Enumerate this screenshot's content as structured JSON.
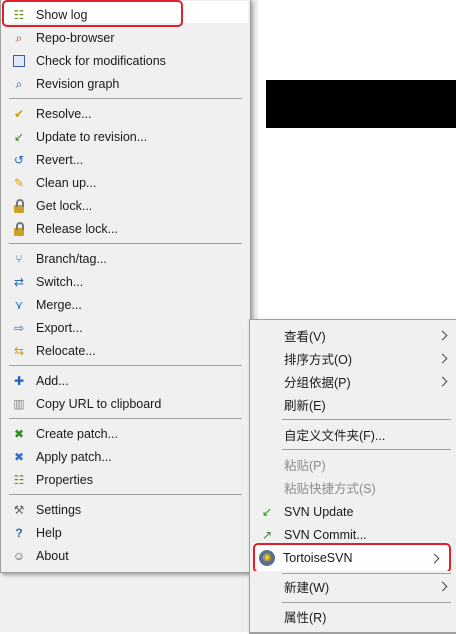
{
  "left_menu": {
    "items": [
      {
        "label": "Show log",
        "icon": "show-log-icon",
        "glyph": "☷",
        "color": "#6b8e23"
      },
      {
        "label": "Repo-browser",
        "icon": "repo-browser-icon",
        "glyph": "🔍",
        "color": "#7a4e12"
      },
      {
        "label": "Check for modifications",
        "icon": "check-modifications-icon",
        "glyph": "▤",
        "color": "#2b5797"
      },
      {
        "label": "Revision graph",
        "icon": "revision-graph-icon",
        "glyph": "⌕",
        "color": "#2b5797"
      },
      {
        "label": "Resolve...",
        "icon": "resolve-icon",
        "glyph": "✔",
        "color": "#c9a000"
      },
      {
        "label": "Update to revision...",
        "icon": "update-to-revision-icon",
        "glyph": "↙",
        "color": "#2e8b1e"
      },
      {
        "label": "Revert...",
        "icon": "revert-icon",
        "glyph": "↺",
        "color": "#1d5fc4"
      },
      {
        "label": "Clean up...",
        "icon": "clean-up-icon",
        "glyph": "✎",
        "color": "#d9a400"
      },
      {
        "label": "Get lock...",
        "icon": "get-lock-icon",
        "glyph": "",
        "color": "#c9a227"
      },
      {
        "label": "Release lock...",
        "icon": "release-lock-icon",
        "glyph": "",
        "color": "#c9a227"
      },
      {
        "label": "Branch/tag...",
        "icon": "branch-tag-icon",
        "glyph": "⑂",
        "color": "#2b6cb0"
      },
      {
        "label": "Switch...",
        "icon": "switch-icon",
        "glyph": "⇄",
        "color": "#2b6cb0"
      },
      {
        "label": "Merge...",
        "icon": "merge-icon",
        "glyph": "⋎",
        "color": "#2b6cb0"
      },
      {
        "label": "Export...",
        "icon": "export-icon",
        "glyph": "⇨",
        "color": "#2b6cb0"
      },
      {
        "label": "Relocate...",
        "icon": "relocate-icon",
        "glyph": "⇆",
        "color": "#c9a000"
      },
      {
        "label": "Add...",
        "icon": "add-icon",
        "glyph": "✚",
        "color": "#1d5fc4"
      },
      {
        "label": "Copy URL to clipboard",
        "icon": "copy-url-icon",
        "glyph": "▥",
        "color": "#888888"
      },
      {
        "label": "Create patch...",
        "icon": "create-patch-icon",
        "glyph": "✖",
        "color": "#2e8b1e"
      },
      {
        "label": "Apply patch...",
        "icon": "apply-patch-icon",
        "glyph": "✖",
        "color": "#3a6fd8"
      },
      {
        "label": "Properties",
        "icon": "properties-icon",
        "glyph": "☷",
        "color": "#6b8e23"
      },
      {
        "label": "Settings",
        "icon": "settings-icon",
        "glyph": "⚒",
        "color": "#666666"
      },
      {
        "label": "Help",
        "icon": "help-icon",
        "glyph": "?",
        "color": "#2b6cb0"
      },
      {
        "label": "About",
        "icon": "about-icon",
        "glyph": "☺",
        "color": "#555555"
      }
    ]
  },
  "right_menu": {
    "items": [
      {
        "label": "查看(V)",
        "submenu": true,
        "disabled": false
      },
      {
        "label": "排序方式(O)",
        "submenu": true,
        "disabled": false
      },
      {
        "label": "分组依据(P)",
        "submenu": true,
        "disabled": false
      },
      {
        "label": "刷新(E)",
        "submenu": false,
        "disabled": false
      },
      {
        "label": "自定义文件夹(F)...",
        "submenu": false,
        "disabled": false
      },
      {
        "label": "粘贴(P)",
        "submenu": false,
        "disabled": true
      },
      {
        "label": "粘贴快捷方式(S)",
        "submenu": false,
        "disabled": true
      },
      {
        "label": "SVN Update",
        "submenu": false,
        "disabled": false,
        "icon": "svn-update-icon"
      },
      {
        "label": "SVN Commit...",
        "submenu": false,
        "disabled": false,
        "icon": "svn-commit-icon"
      },
      {
        "label": "TortoiseSVN",
        "submenu": true,
        "disabled": false,
        "icon": "tortoisesvn-icon"
      },
      {
        "label": "新建(W)",
        "submenu": true,
        "disabled": false
      },
      {
        "label": "属性(R)",
        "submenu": false,
        "disabled": false
      }
    ]
  },
  "colors": {
    "highlight_border": "#e0202a",
    "menu_background": "#f0f0f0",
    "separator": "#a0a0a0"
  }
}
